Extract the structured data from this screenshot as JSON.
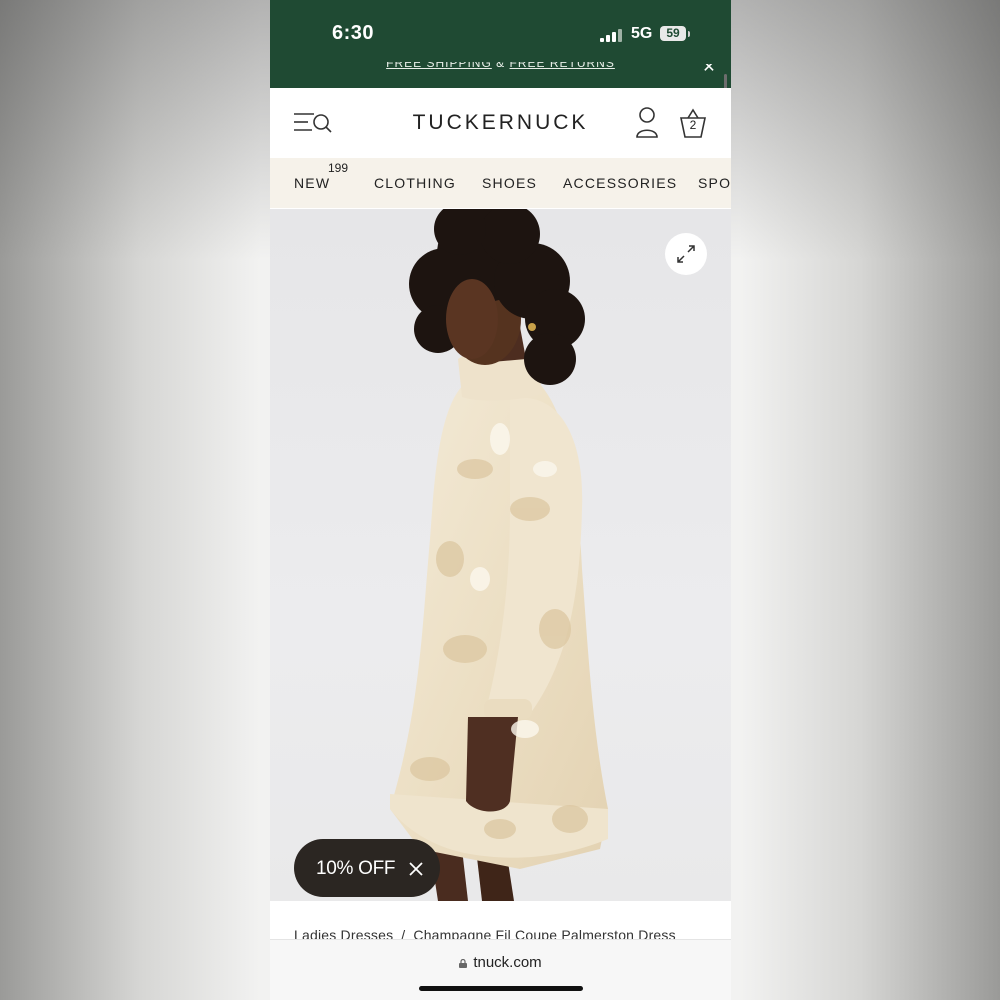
{
  "status_bar": {
    "time": "6:30",
    "network": "5G",
    "battery": "59"
  },
  "promo": {
    "text_1": "FREE SHIPPING",
    "joiner": "&",
    "text_2": "FREE RETURNS"
  },
  "header": {
    "brand": "TUCKERNUCK",
    "cart_count": "2",
    "menu_icon": "menu-search-icon",
    "account_icon": "user-icon",
    "cart_icon": "shopping-bag-icon"
  },
  "nav": {
    "items": [
      {
        "label": "NEW",
        "count": "199"
      },
      {
        "label": "CLOTHING"
      },
      {
        "label": "SHOES"
      },
      {
        "label": "ACCESSORIES"
      },
      {
        "label": "SPO"
      }
    ]
  },
  "product": {
    "expand_icon": "expand-icon",
    "discount_label": "10% OFF"
  },
  "breadcrumb": {
    "items": [
      "Ladies Dresses",
      "Champagne Fil Coupe Palmerston Dress"
    ],
    "separator": "/"
  },
  "browser": {
    "url": "tnuck.com"
  },
  "colors": {
    "banner_green": "#1f4a33",
    "nav_background": "#f6f2ea",
    "pill_dark": "#2b2622"
  }
}
